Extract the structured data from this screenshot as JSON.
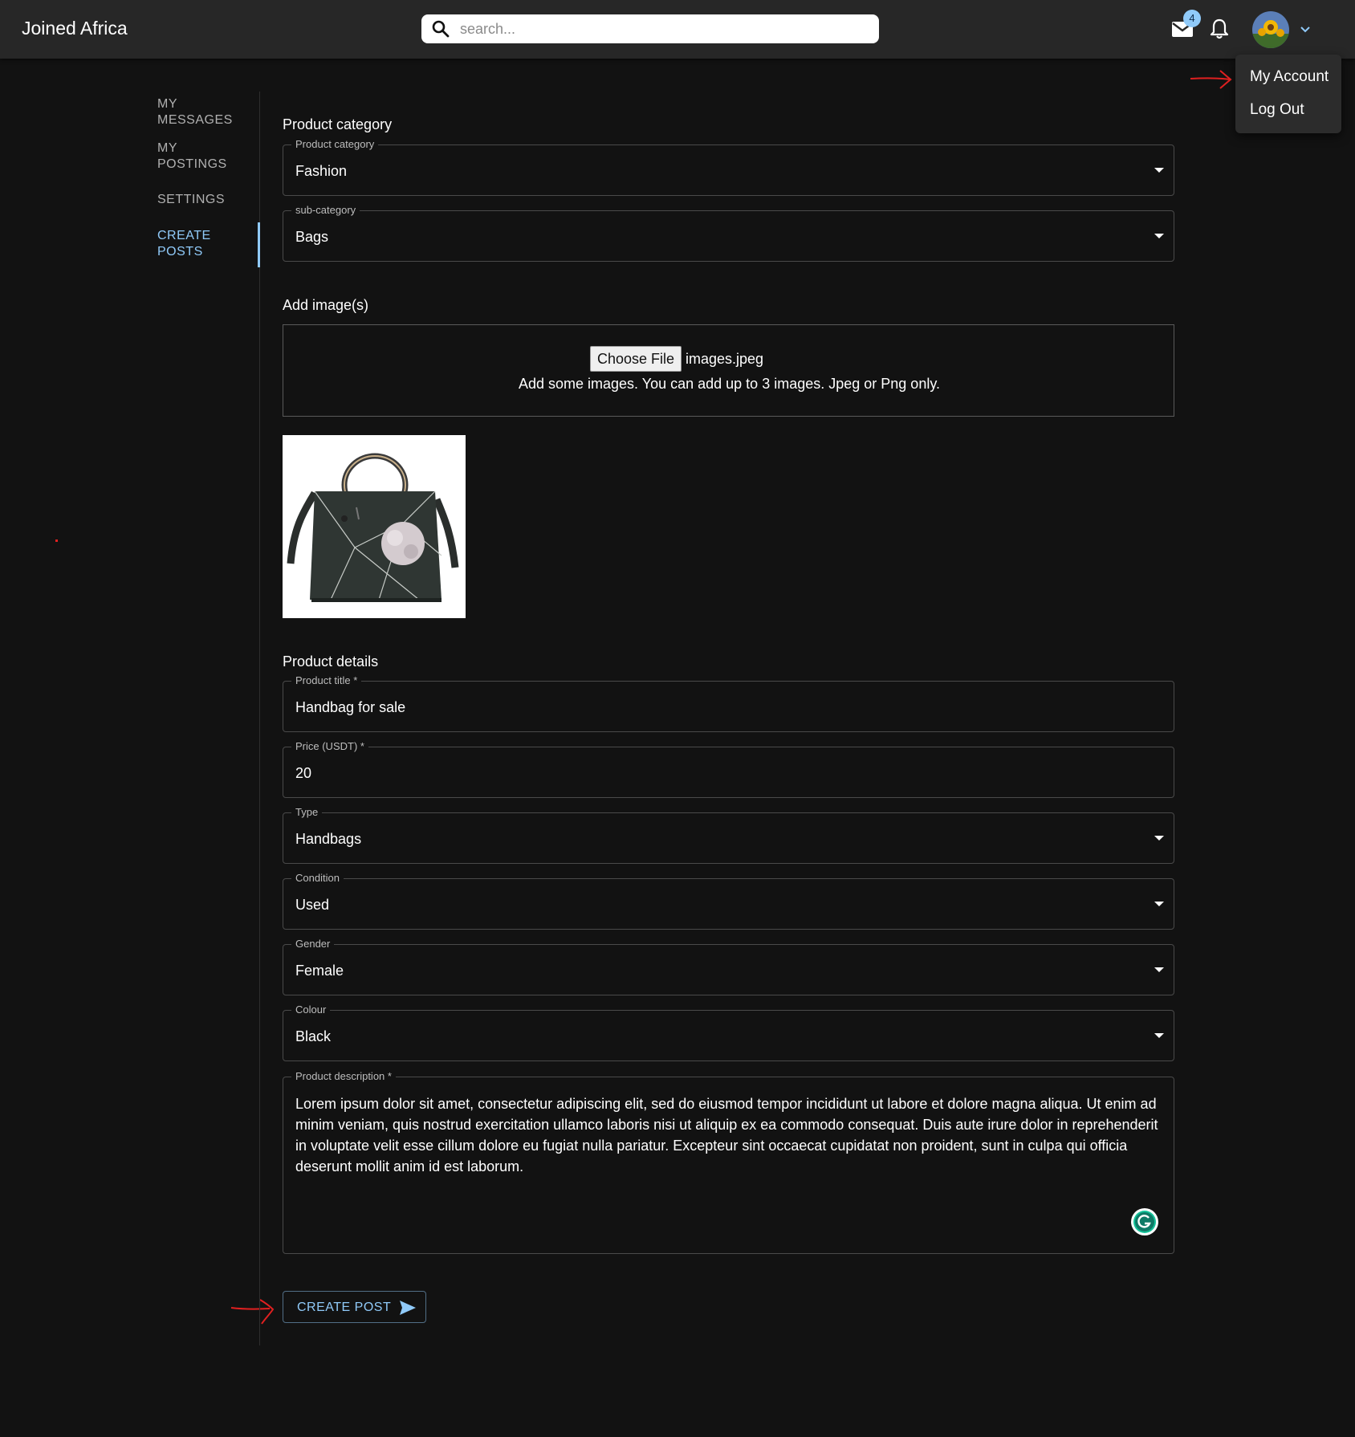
{
  "app": {
    "title": "Joined Africa"
  },
  "search": {
    "placeholder": "search..."
  },
  "header": {
    "mail_badge": "4"
  },
  "account_menu": {
    "items": [
      "My Account",
      "Log Out"
    ]
  },
  "sidebar": {
    "items": [
      {
        "label": "MY MESSAGES",
        "active": false
      },
      {
        "label": "MY POSTINGS",
        "active": false
      },
      {
        "label": "SETTINGS",
        "active": false
      },
      {
        "label": "CREATE POSTS",
        "active": true
      }
    ]
  },
  "form": {
    "category_section_title": "Product category",
    "product_category": {
      "label": "Product category",
      "value": "Fashion"
    },
    "sub_category": {
      "label": "sub-category",
      "value": "Bags"
    },
    "images_section_title": "Add image(s)",
    "upload": {
      "button_label": "Choose File",
      "file_name": "images.jpeg",
      "hint": "Add some images. You can add up to 3 images. Jpeg or Png only."
    },
    "details_section_title": "Product details",
    "product_title": {
      "label": "Product title *",
      "value": "Handbag for sale"
    },
    "price": {
      "label": "Price (USDT) *",
      "value": "20"
    },
    "type": {
      "label": "Type",
      "value": "Handbags"
    },
    "condition": {
      "label": "Condition",
      "value": "Used"
    },
    "gender": {
      "label": "Gender",
      "value": "Female"
    },
    "colour": {
      "label": "Colour",
      "value": "Black"
    },
    "description": {
      "label": "Product description *",
      "value": "Lorem ipsum dolor sit amet, consectetur adipiscing elit, sed do eiusmod tempor incididunt ut labore et dolore magna aliqua. Ut enim ad minim veniam, quis nostrud exercitation ullamco laboris nisi ut aliquip ex ea commodo consequat. Duis aute irure dolor in reprehenderit in voluptate velit esse cillum dolore eu fugiat nulla pariatur. Excepteur sint occaecat cupidatat non proident, sunt in culpa qui officia deserunt mollit anim id est laborum."
    },
    "submit_label": "CREATE POST"
  },
  "colors": {
    "background": "#121212",
    "appbar": "#272727",
    "accent": "#90caf9",
    "annotation_arrow": "#e02020"
  },
  "icons": [
    "search-icon",
    "mail-icon",
    "bell-icon",
    "chevron-down-icon",
    "send-icon",
    "grammarly-icon"
  ]
}
